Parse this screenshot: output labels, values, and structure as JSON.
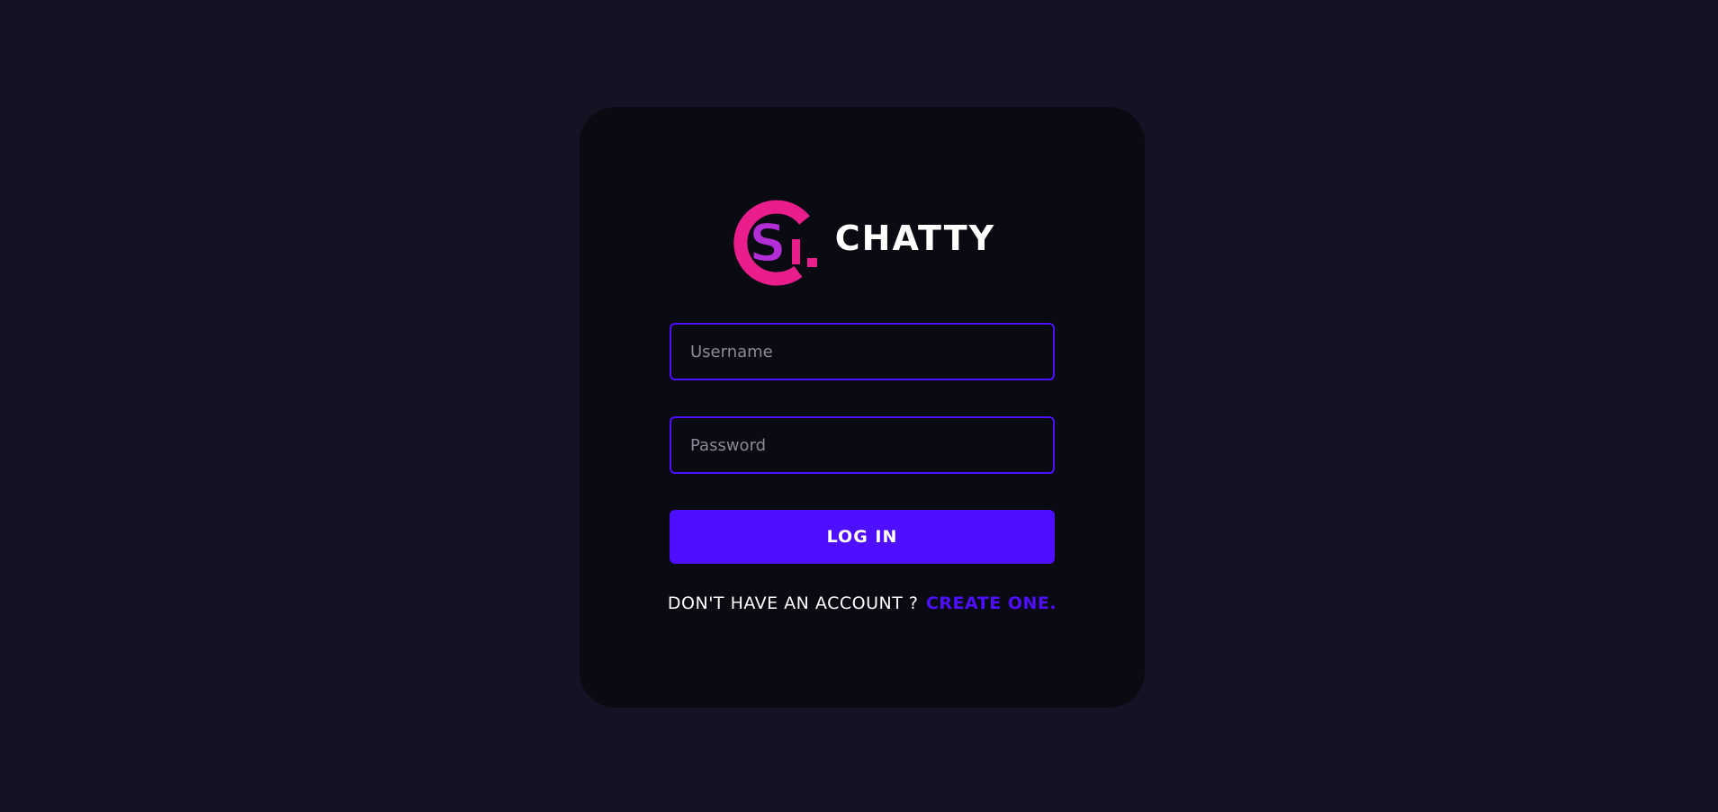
{
  "theme": {
    "background": "#131324",
    "card_background": "#0a0a12",
    "accent": "#4e0eff",
    "logo_pink": "#e91e8c",
    "logo_purple": "#b42ed8"
  },
  "brand": {
    "name": "CHATTY",
    "logo_icon": "chatty-logo-icon"
  },
  "form": {
    "username_placeholder": "Username",
    "username_value": "",
    "password_placeholder": "Password",
    "password_value": "",
    "submit_label": "LOG IN"
  },
  "signup": {
    "prompt": "DON'T HAVE AN ACCOUNT ?",
    "link_label": "CREATE ONE."
  }
}
